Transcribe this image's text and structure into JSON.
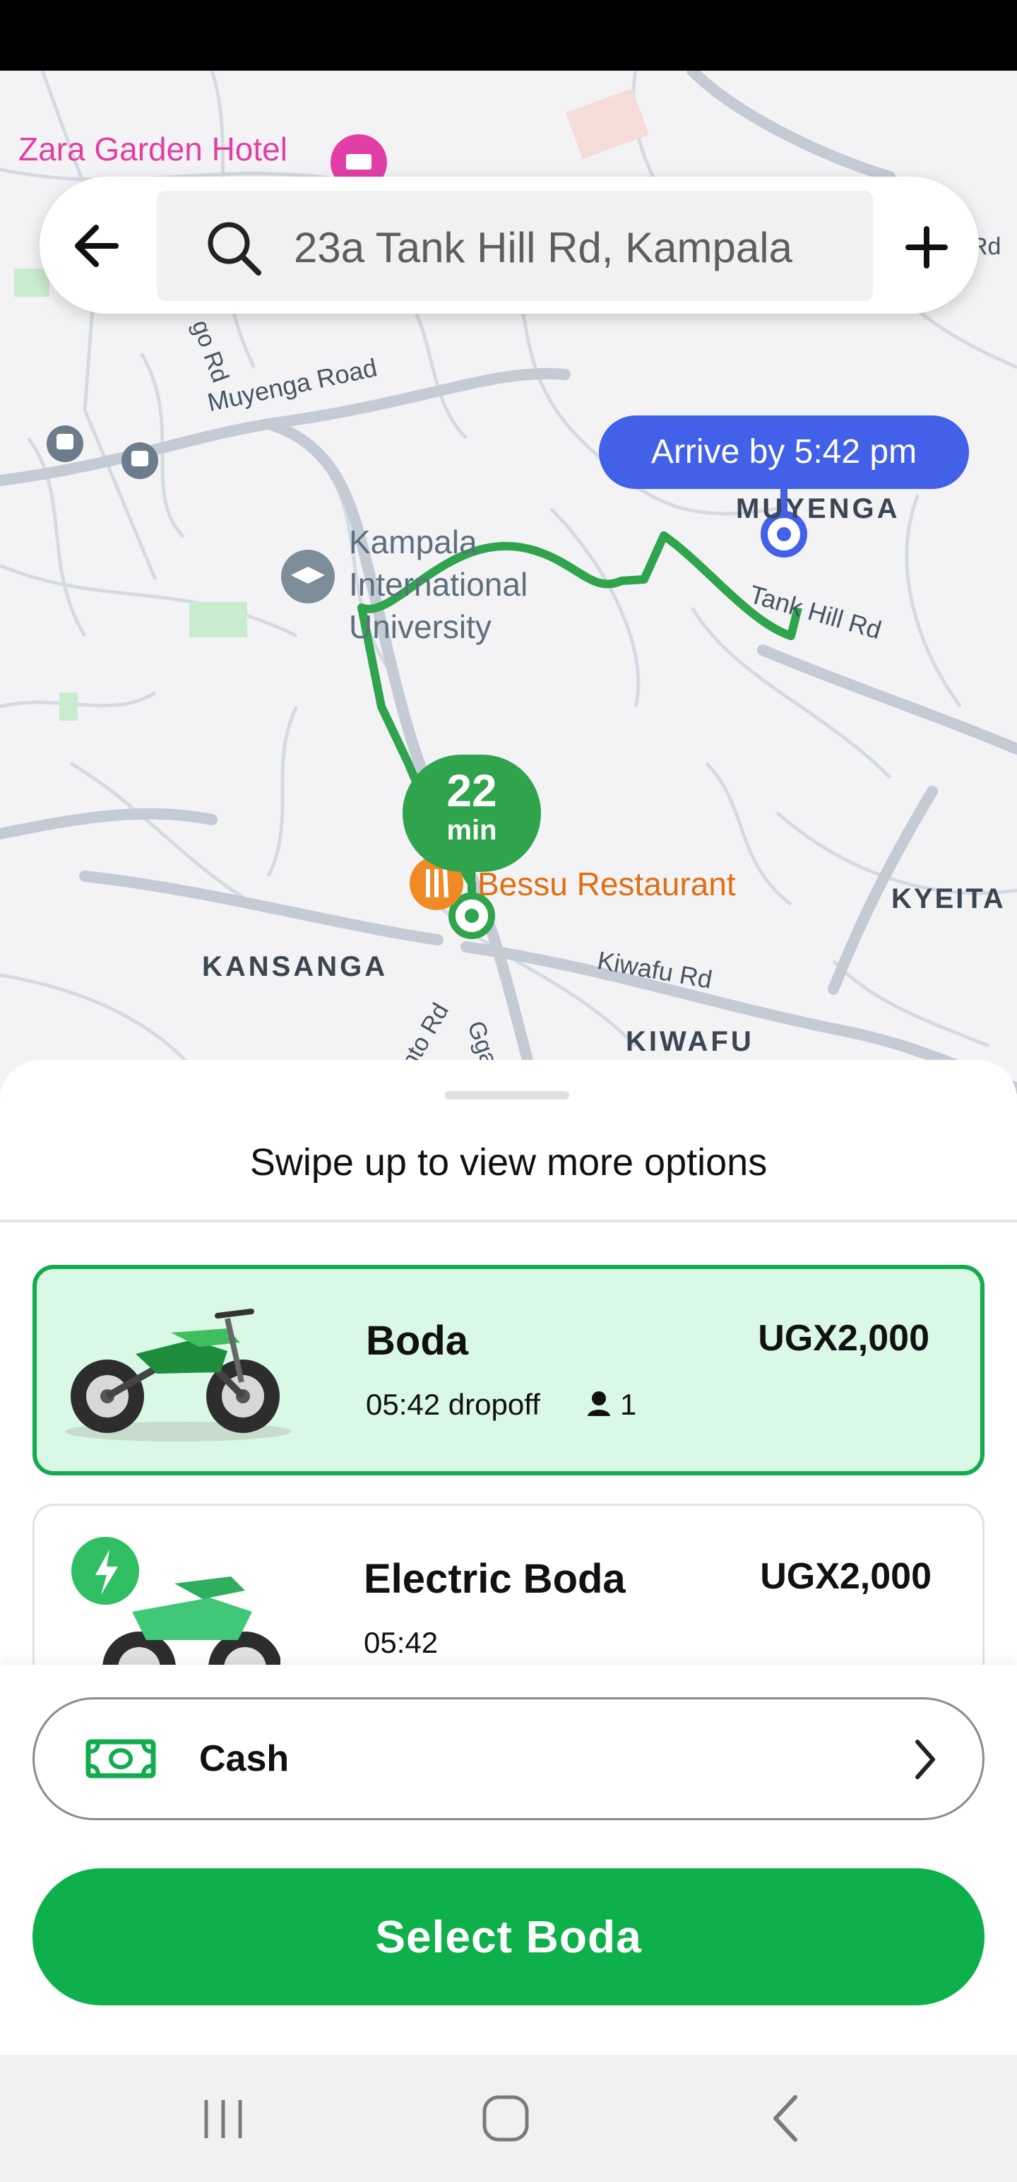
{
  "search": {
    "destination": "23a Tank Hill Rd, Kampala"
  },
  "map": {
    "arrive_label": "Arrive by 5:42 pm",
    "eta_value": "22",
    "eta_unit": "min",
    "labels": {
      "hotel": "Zara Garden Hotel",
      "muyenga_road": "Muyenga Road",
      "university_1": "Kampala",
      "university_2": "International",
      "university_3": "University",
      "muyenga": "MUYENGA",
      "tank_hill": "Tank Hill Rd",
      "restaurant": "Bessu Restaurant",
      "kansanga": "KANSANGA",
      "kiwafu_rd": "Kiwafu Rd",
      "kiwafu": "KIWAFU",
      "kyeitabi": "KYEITA",
      "rd_partial_1": "Rd",
      "rd_partial_2": "go Rd",
      "rd_partial_3": "nto Rd",
      "rd_partial_4": "Gga"
    },
    "route_color": "#2fa44d",
    "destination_color": "#4260e8"
  },
  "sheet": {
    "swipe_hint": "Swipe up to view more options"
  },
  "rides": [
    {
      "name": "Boda",
      "price": "UGX2,000",
      "dropoff": "05:42 dropoff",
      "seats": "1",
      "selected": true
    },
    {
      "name": "Electric Boda",
      "price": "UGX2,000",
      "dropoff": "05:42",
      "selected": false
    }
  ],
  "payment": {
    "method": "Cash"
  },
  "cta": {
    "label": "Select Boda"
  },
  "colors": {
    "brand_green": "#0db04b",
    "selected_bg": "#d9f8e6"
  }
}
